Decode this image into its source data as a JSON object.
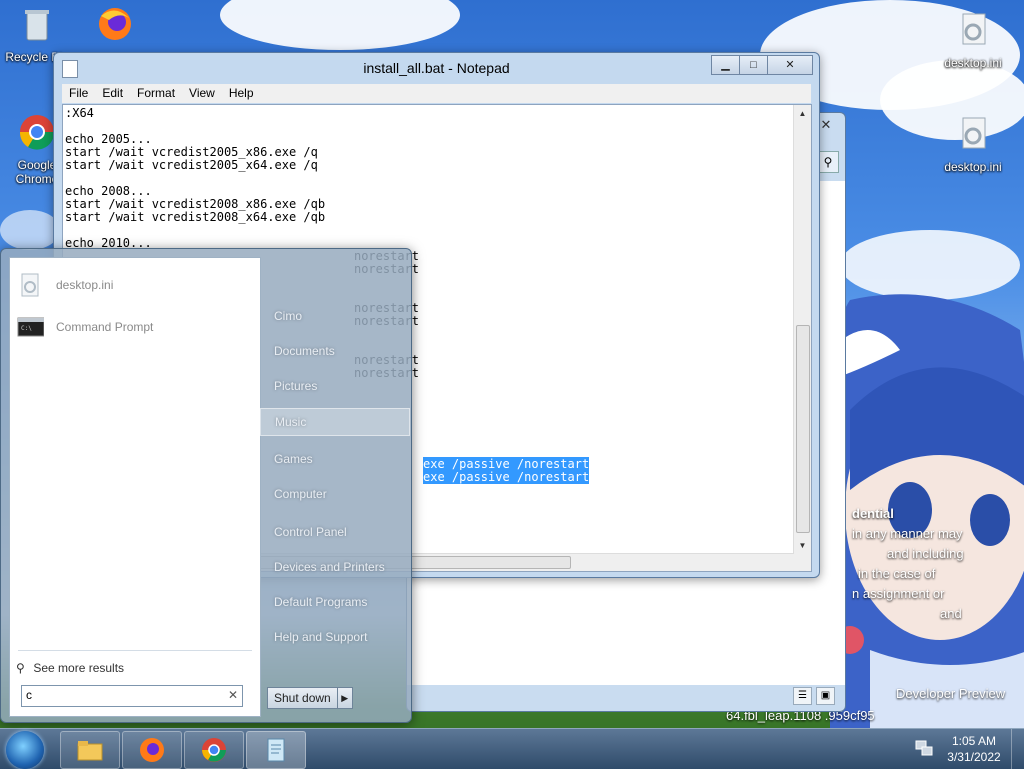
{
  "desktop": {
    "icons": [
      {
        "label": "Recycle Bin"
      },
      {
        "label": ""
      },
      {
        "label": "Google Chrome"
      },
      {
        "label": "desktop.ini"
      },
      {
        "label": "desktop.ini"
      }
    ],
    "watermark": {
      "line1": "dential",
      "line2": "in any manner may",
      "line3": "and including",
      "line4": "in the case of",
      "line5": "n assignment or",
      "line6": "and",
      "line7": "Developer Preview",
      "line8": "64.fbl_leap.1108 .959cf95"
    }
  },
  "notepad": {
    "title": "install_all.bat - Notepad",
    "menu": [
      "File",
      "Edit",
      "Format",
      "View",
      "Help"
    ],
    "text": ":X64\n\necho 2005...\nstart /wait vcredist2005_x86.exe /q\nstart /wait vcredist2005_x64.exe /q\n\necho 2008...\nstart /wait vcredist2008_x86.exe /qb\nstart /wait vcredist2008_x64.exe /qb\n\necho 2010...\n                                        norestart\n                                        norestart\n\n\n                                        norestart\n                                        norestart\n\n\n                                        norestart\n                                        norestart\n",
    "selected_lines": [
      "exe /passive /norestart",
      "exe /passive /norestart"
    ]
  },
  "start_menu": {
    "results": [
      {
        "label": "desktop.ini",
        "icon": "ini-file-icon"
      },
      {
        "label": "Command Prompt",
        "icon": "cmd-icon"
      }
    ],
    "see_more": "See more results",
    "search_value": "c",
    "right_links": [
      "Cimo",
      "Documents",
      "Pictures",
      "Music",
      "Games",
      "Computer",
      "Control Panel",
      "Devices and Printers",
      "Default Programs",
      "Help and Support"
    ],
    "hover_link": "Music",
    "shutdown_label": "Shut down"
  },
  "taskbar": {
    "apps": [
      "file-explorer",
      "firefox",
      "chrome",
      "notepad"
    ],
    "time": "1:05 AM",
    "date": "3/31/2022"
  }
}
